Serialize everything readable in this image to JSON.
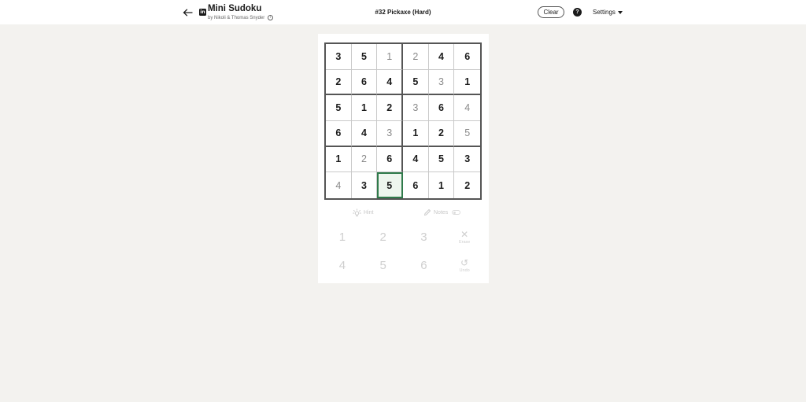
{
  "header": {
    "app_title": "Mini Sudoku",
    "byline": "by Nikoli & Thomas Snyder",
    "brand_logo": "in",
    "puzzle_title": "#32 Pickaxe (Hard)",
    "clear_label": "Clear",
    "help_label": "?",
    "settings_label": "Settings"
  },
  "board": {
    "size": 6,
    "selected": {
      "row": 6,
      "col": 3
    },
    "selected_color": "#2f7a4a",
    "cells": [
      [
        {
          "v": "3",
          "t": "given"
        },
        {
          "v": "5",
          "t": "given"
        },
        {
          "v": "1",
          "t": "prefilled"
        },
        {
          "v": "2",
          "t": "prefilled"
        },
        {
          "v": "4",
          "t": "given"
        },
        {
          "v": "6",
          "t": "given"
        }
      ],
      [
        {
          "v": "2",
          "t": "given"
        },
        {
          "v": "6",
          "t": "given"
        },
        {
          "v": "4",
          "t": "given"
        },
        {
          "v": "5",
          "t": "given"
        },
        {
          "v": "3",
          "t": "prefilled"
        },
        {
          "v": "1",
          "t": "given"
        }
      ],
      [
        {
          "v": "5",
          "t": "given"
        },
        {
          "v": "1",
          "t": "given"
        },
        {
          "v": "2",
          "t": "given"
        },
        {
          "v": "3",
          "t": "prefilled"
        },
        {
          "v": "6",
          "t": "given"
        },
        {
          "v": "4",
          "t": "prefilled"
        }
      ],
      [
        {
          "v": "6",
          "t": "given"
        },
        {
          "v": "4",
          "t": "given"
        },
        {
          "v": "3",
          "t": "prefilled"
        },
        {
          "v": "1",
          "t": "given"
        },
        {
          "v": "2",
          "t": "given"
        },
        {
          "v": "5",
          "t": "prefilled"
        }
      ],
      [
        {
          "v": "1",
          "t": "given"
        },
        {
          "v": "2",
          "t": "prefilled"
        },
        {
          "v": "6",
          "t": "given"
        },
        {
          "v": "4",
          "t": "given"
        },
        {
          "v": "5",
          "t": "given"
        },
        {
          "v": "3",
          "t": "given"
        }
      ],
      [
        {
          "v": "4",
          "t": "prefilled"
        },
        {
          "v": "3",
          "t": "given"
        },
        {
          "v": "5",
          "t": "given"
        },
        {
          "v": "6",
          "t": "given"
        },
        {
          "v": "1",
          "t": "given"
        },
        {
          "v": "2",
          "t": "given"
        }
      ]
    ]
  },
  "tools": {
    "hint_label": "Hint",
    "hint_icon": "lightbulb-icon",
    "notes_label": "Notes",
    "notes_icon": "pencil-icon"
  },
  "numpad": {
    "row1": [
      "1",
      "2",
      "3"
    ],
    "row2": [
      "4",
      "5",
      "6"
    ],
    "erase_label": "Erase",
    "erase_glyph": "✕",
    "undo_label": "Undo",
    "undo_glyph": "↺"
  }
}
